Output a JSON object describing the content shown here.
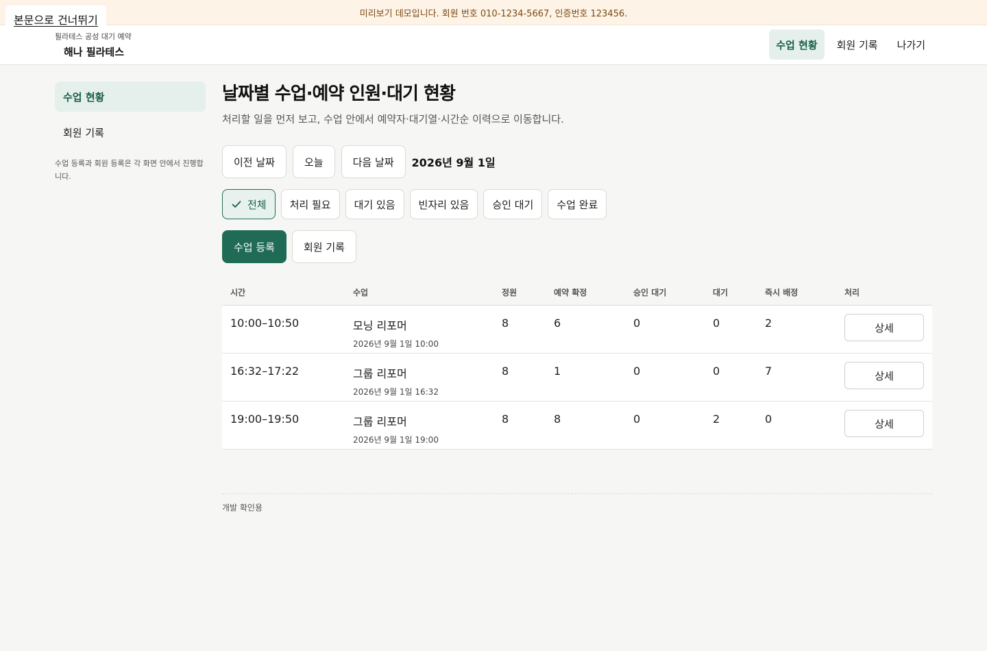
{
  "skip_link": "본문으로 건너뛰기",
  "notice": "미리보기 데모입니다. 회원 번호 010-1234-5667, 인증번호 123456.",
  "brand": {
    "subtitle": "필라테스 공성 대기 예약",
    "name": "해나 필라테스"
  },
  "topnav": {
    "items": [
      {
        "label": "수업 현황",
        "active": true
      },
      {
        "label": "회원 기록",
        "active": false
      },
      {
        "label": "나가기",
        "active": false
      }
    ]
  },
  "sidebar": {
    "items": [
      {
        "label": "수업 현황",
        "active": true
      },
      {
        "label": "회원 기록",
        "active": false
      }
    ],
    "note": "수업 등록과 회원 등록은 각 화면 안에서 진행합니다."
  },
  "main": {
    "title": "날짜별 수업·예약 인원·대기 현황",
    "description": "처리할 일을 먼저 보고, 수업 안에서 예약자·대기열·시간순 이력으로 이동합니다.",
    "date_nav": {
      "prev": "이전 날짜",
      "today": "오늘",
      "next": "다음 날짜",
      "current": "2026년 9월 1일"
    },
    "filters": [
      {
        "label": "전체",
        "active": true
      },
      {
        "label": "처리 필요",
        "active": false
      },
      {
        "label": "대기 있음",
        "active": false
      },
      {
        "label": "빈자리 있음",
        "active": false
      },
      {
        "label": "승인 대기",
        "active": false
      },
      {
        "label": "수업 완료",
        "active": false
      }
    ],
    "actions": {
      "register_class": "수업 등록",
      "member_records": "회원 기록"
    },
    "table": {
      "headers": {
        "time": "시간",
        "class": "수업",
        "capacity": "정원",
        "confirmed": "예약 확정",
        "approval": "승인 대기",
        "waiting": "대기",
        "instant": "즉시 배정",
        "action": "처리"
      },
      "rows": [
        {
          "time": "10:00–10:50",
          "class": "모닝 리포머",
          "datetime": "2026년 9월 1일 10:00",
          "capacity": "8",
          "confirmed": "6",
          "approval": "0",
          "waiting": "0",
          "instant": "2",
          "action": "상세"
        },
        {
          "time": "16:32–17:22",
          "class": "그룹 리포머",
          "datetime": "2026년 9월 1일 16:32",
          "capacity": "8",
          "confirmed": "1",
          "approval": "0",
          "waiting": "0",
          "instant": "7",
          "action": "상세"
        },
        {
          "time": "19:00–19:50",
          "class": "그룹 리포머",
          "datetime": "2026년 9월 1일 19:00",
          "capacity": "8",
          "confirmed": "8",
          "approval": "0",
          "waiting": "2",
          "instant": "0",
          "action": "상세"
        }
      ]
    }
  },
  "footer": {
    "dev_note": "개발 확인용"
  },
  "colors": {
    "accent": "#1f6b55",
    "accent_light": "#e5f0ec",
    "notice_bg": "#fdf3e6",
    "page_bg": "#f6f6f4"
  },
  "icons": {
    "filter_active": "check-icon"
  }
}
